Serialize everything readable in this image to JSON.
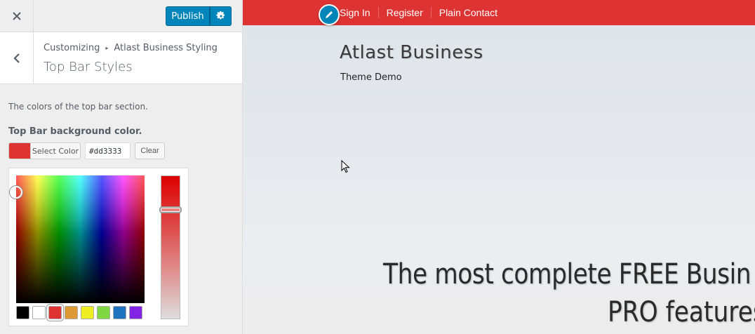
{
  "header": {
    "close_icon": "close-icon",
    "publish_label": "Publish",
    "settings_icon": "gear-icon"
  },
  "section": {
    "back_icon": "chevron-left-icon",
    "breadcrumb_root": "Customizing",
    "breadcrumb_sep_icon": "triangle-right-icon",
    "breadcrumb_parent": "Atlast Business Styling",
    "title": "Top Bar Styles"
  },
  "control": {
    "description": "The colors of the top bar section.",
    "label": "Top Bar background color.",
    "select_label": "Select Color",
    "hex_value": "#dd3333",
    "clear_label": "Clear",
    "current_color": "#dd3333",
    "palette": [
      "#000000",
      "#ffffff",
      "#dd3333",
      "#dd9933",
      "#eeee22",
      "#81d742",
      "#1e73be",
      "#8224e3"
    ],
    "selected_palette_index": 2
  },
  "preview": {
    "top_bar_color": "#dd3333",
    "edit_icon": "pencil-icon",
    "menu": [
      "Sign In",
      "Register",
      "Plain Contact"
    ],
    "site_title": "Atlast Business",
    "site_tagline": "Theme Demo",
    "hero_line1": "The most complete FREE Busin",
    "hero_line2": "PRO features"
  }
}
